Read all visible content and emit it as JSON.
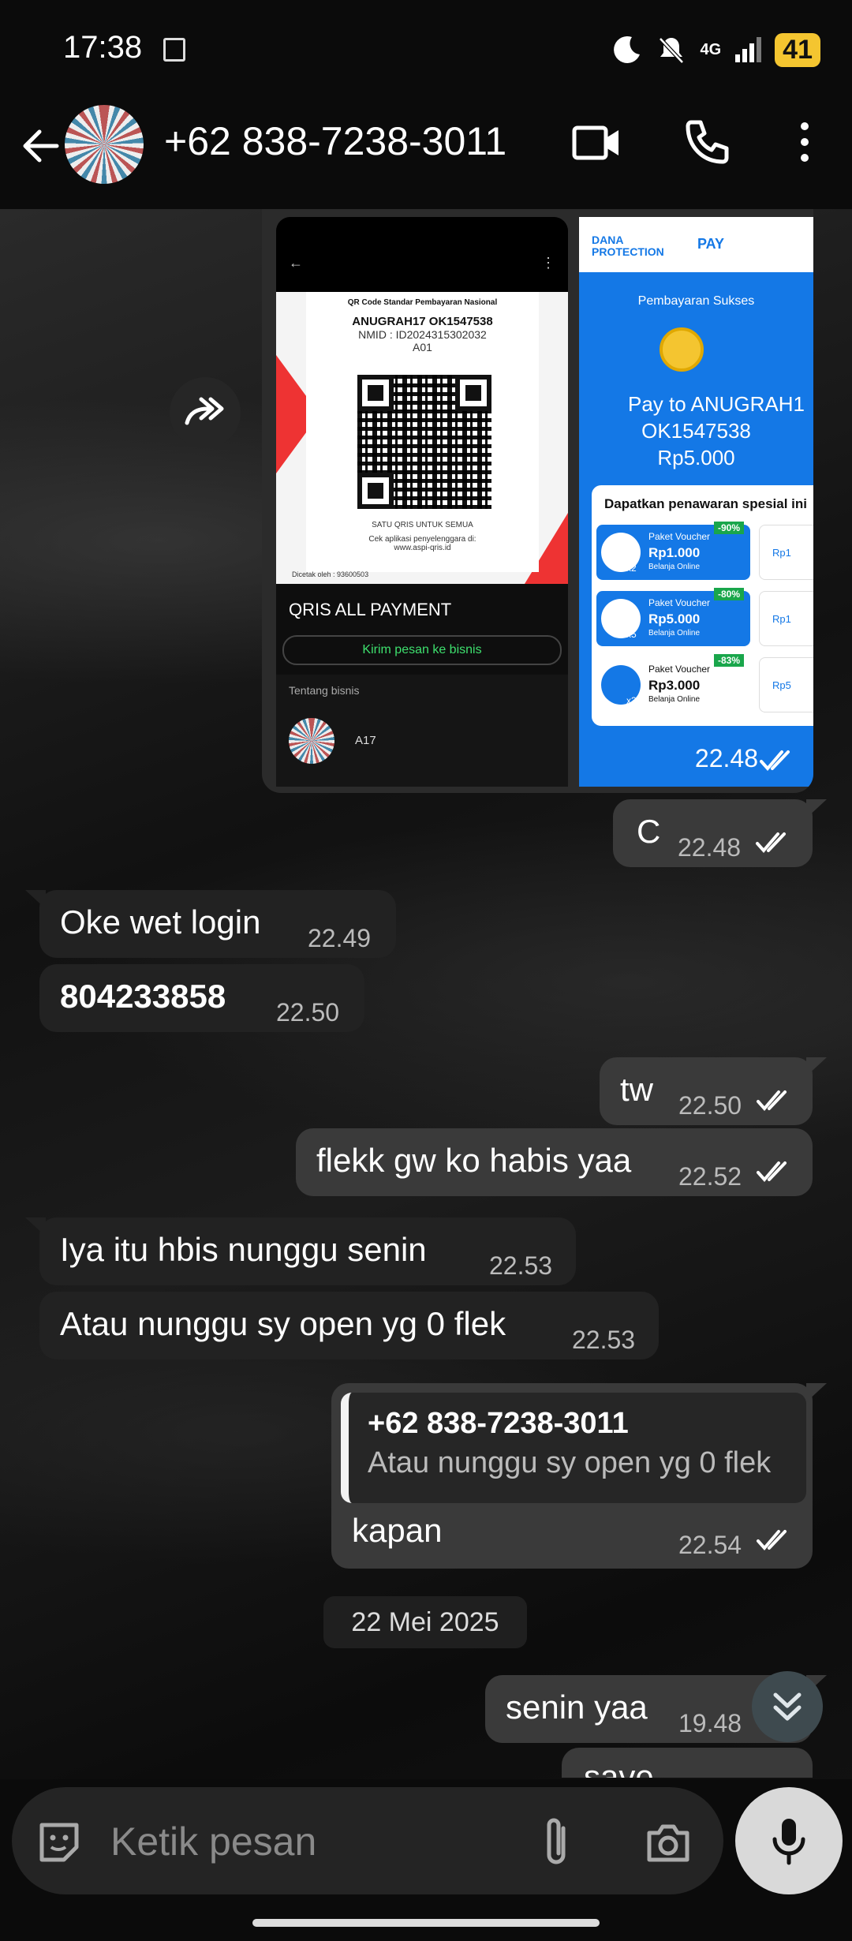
{
  "status_bar": {
    "time": "17:38",
    "network": "4G",
    "battery": "41"
  },
  "header": {
    "contact": "+62 838-7238-3011"
  },
  "image_message": {
    "left_shot": {
      "qris_title": "QR Code Standar Pembayaran Nasional",
      "merchant": "ANUGRAH17 OK1547538",
      "nmid": "NMID : ID2024315302032",
      "code": "A01",
      "footer1": "SATU QRIS UNTUK SEMUA",
      "footer2": "Cek aplikasi penyelenggara di: www.aspi-qris.id",
      "printed": "Dicetak oleh : 93600503",
      "qris_all": "QRIS ALL PAYMENT",
      "kirim": "Kirim pesan ke bisnis",
      "tentang": "Tentang bisnis",
      "biz_name": "A17"
    },
    "right_shot": {
      "brand1": "DANA PROTECTION",
      "brand2": "PAY",
      "status": "Pembayaran Sukses",
      "pay_to": "Pay to ANUGRAH1",
      "pay_to2": "OK1547538",
      "amount": "Rp5.000",
      "offer_title": "Dapatkan penawaran spesial ini",
      "vouchers": [
        {
          "label": "Paket Voucher",
          "price": "Rp1.000",
          "note": "Belanja Online",
          "disc": "-90%",
          "qty": "x2",
          "side": "Rp1"
        },
        {
          "label": "Paket Voucher",
          "price": "Rp5.000",
          "note": "Belanja Online",
          "disc": "-80%",
          "qty": "x5",
          "side": "Rp1"
        },
        {
          "label": "Paket Voucher",
          "price": "Rp3.000",
          "note": "Belanja Online",
          "disc": "-83%",
          "qty": "x3",
          "side": "Rp5"
        }
      ]
    },
    "time": "22.48"
  },
  "messages": [
    {
      "text": "C",
      "time": "22.48"
    },
    {
      "text": "Oke wet login",
      "time": "22.49"
    },
    {
      "text": "804233858",
      "time": "22.50"
    },
    {
      "text": "tw",
      "time": "22.50"
    },
    {
      "text": "flekk gw ko habis yaa",
      "time": "22.52"
    },
    {
      "text": "Iya itu hbis nunggu senin",
      "time": "22.53"
    },
    {
      "text": "Atau nunggu sy open yg 0 flek",
      "time": "22.53"
    },
    {
      "text": "kapan",
      "time": "22.54",
      "quote_author": "+62 838-7238-3011",
      "quote_text": "Atau nunggu sy open yg 0 flek"
    },
    {
      "text": "senin yaa",
      "time": "19.48"
    },
    {
      "text": "save"
    }
  ],
  "date_chip": "22 Mei 2025",
  "composer": {
    "placeholder": "Ketik pesan"
  }
}
